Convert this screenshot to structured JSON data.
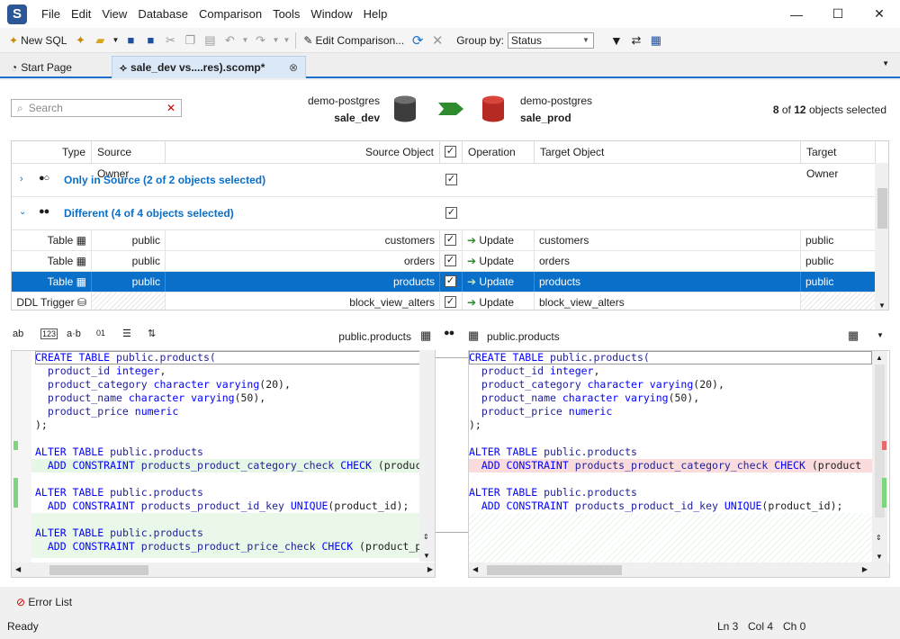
{
  "menu": [
    "File",
    "Edit",
    "View",
    "Database",
    "Comparison",
    "Tools",
    "Window",
    "Help"
  ],
  "window_controls": {
    "minimize": "—",
    "maximize": "☐",
    "close": "✕"
  },
  "toolbar": {
    "new_sql": "New SQL",
    "edit_comparison": "Edit Comparison...",
    "group_by_label": "Group by:",
    "group_by_value": "Status"
  },
  "tabs": [
    {
      "label": "Start Page"
    },
    {
      "label": "sale_dev vs....res).scomp*"
    }
  ],
  "header": {
    "search_placeholder": "Search",
    "source_server": "demo-postgres",
    "source_db": "sale_dev",
    "target_server": "demo-postgres",
    "target_db": "sale_prod",
    "selected_count": "8",
    "of_word": "of",
    "total_count": "12",
    "selected_suffix": "objects selected"
  },
  "grid": {
    "columns": {
      "type": "Type",
      "source_owner": "Source Owner",
      "source_object": "Source Object",
      "operation": "Operation",
      "target_object": "Target Object",
      "target_owner": "Target Owner"
    },
    "groups": [
      {
        "label": "Only in Source (2 of 2 objects selected)",
        "expanded": false
      },
      {
        "label": "Different (4 of 4 objects selected)",
        "expanded": true
      }
    ],
    "rows": [
      {
        "type": "Table",
        "source_owner": "public",
        "source_object": "customers",
        "operation": "Update",
        "target_object": "customers",
        "target_owner": "public"
      },
      {
        "type": "Table",
        "source_owner": "public",
        "source_object": "orders",
        "operation": "Update",
        "target_object": "orders",
        "target_owner": "public"
      },
      {
        "type": "Table",
        "source_owner": "public",
        "source_object": "products",
        "operation": "Update",
        "target_object": "products",
        "target_owner": "public"
      },
      {
        "type": "DDL Trigger",
        "source_owner": "",
        "source_object": "block_view_alters",
        "operation": "Update",
        "target_object": "block_view_alters",
        "target_owner": ""
      }
    ]
  },
  "diff": {
    "source_title": "public.products",
    "target_title": "public.products",
    "source_lines": [
      "CREATE TABLE public.products(",
      "  product_id integer,",
      "  product_category character varying(20),",
      "  product_name character varying(50),",
      "  product_price numeric",
      ");",
      "",
      "ALTER TABLE public.products",
      "  ADD CONSTRAINT products_product_category_check CHECK (product",
      "",
      "ALTER TABLE public.products",
      "  ADD CONSTRAINT products_product_id_key UNIQUE(product_id);",
      "",
      "ALTER TABLE public.products",
      "  ADD CONSTRAINT products_product_price_check CHECK (product_pr"
    ],
    "target_lines": [
      "CREATE TABLE public.products(",
      "  product_id integer,",
      "  product_category character varying(20),",
      "  product_name character varying(50),",
      "  product_price numeric",
      ");",
      "",
      "ALTER TABLE public.products",
      "  ADD CONSTRAINT products_product_category_check CHECK (product",
      "",
      "ALTER TABLE public.products",
      "  ADD CONSTRAINT products_product_id_key UNIQUE(product_id);"
    ]
  },
  "bottom_tab": "Error List",
  "status": {
    "state": "Ready",
    "ln": "Ln 3",
    "col": "Col 4",
    "ch": "Ch 0"
  },
  "colors": {
    "accent": "#0a6fc9",
    "group_text": "#0a6fc9",
    "added_bg": "#e6f7e6",
    "removed_bg": "#fbdcdc"
  }
}
